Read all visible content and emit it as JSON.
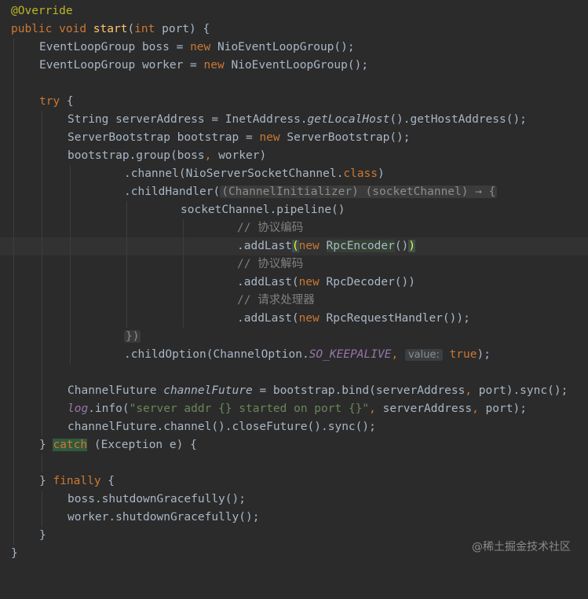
{
  "editor": {
    "annotation": "@Override",
    "method_line": {
      "mod1": "public",
      "mod2": "void",
      "name": "start",
      "paren_open": "(",
      "ptype": "int",
      "pname": "port",
      "tail": ") {"
    },
    "boss_line": {
      "type": "EventLoopGroup boss = ",
      "kw": "new",
      "rest": " NioEventLoopGroup();"
    },
    "worker_line": {
      "type": "EventLoopGroup worker = ",
      "kw": "new",
      "rest": " NioEventLoopGroup();"
    },
    "try_line": {
      "kw": "try",
      "rest": " {"
    },
    "server_address_line": {
      "a": "String serverAddress = InetAddress.",
      "method": "getLocalHost",
      "b": "().getHostAddress();"
    },
    "bootstrap_line": {
      "a": "ServerBootstrap bootstrap = ",
      "kw": "new",
      "b": " ServerBootstrap();"
    },
    "group_line": {
      "a": "bootstrap.group(boss",
      "comma": ",",
      "b": " worker)"
    },
    "channel_line": {
      "a": ".channel(NioServerSocketChannel.",
      "kw": "class",
      "b": ")"
    },
    "child_handler_line": {
      "a": ".childHandler(",
      "fold": "(ChannelInitializer) (socketChannel) → {"
    },
    "pipeline_line": "socketChannel.pipeline()",
    "comment_encoder": "// 协议编码",
    "add_encoder_line": {
      "a": ".addLast",
      "open": "(",
      "kw": "new",
      "space": " ",
      "cls": "RpcEncoder",
      "b": "()",
      "close": ")"
    },
    "comment_decoder": "// 协议解码",
    "add_decoder_line": {
      "a": ".addLast(",
      "kw": "new",
      "b": " RpcDecoder())"
    },
    "comment_handler": "// 请求处理器",
    "add_handler_line": {
      "a": ".addLast(",
      "kw": "new",
      "b": " RpcRequestHandler());"
    },
    "close_fold_line": "})",
    "child_option_line": {
      "a": ".childOption(ChannelOption.",
      "const": "SO_KEEPALIVE",
      "comma": ",",
      "hint": "value:",
      "val": "true",
      "b": ");"
    },
    "future_line": {
      "a": "ChannelFuture ",
      "var": "channelFuture",
      "b": " = bootstrap.bind(serverAddress",
      "c1": ",",
      "c": " port).sync();"
    },
    "log_line": {
      "log": "log",
      "a": ".info(",
      "str": "\"server addr {} started on port {}\"",
      "c1": ",",
      "b": " serverAddress",
      "c2": ",",
      "c": " port);"
    },
    "close_future_line": "channelFuture.channel().closeFuture().sync();",
    "catch_line": {
      "a": "} ",
      "kw": "catch",
      "b": " (Exception e) {"
    },
    "finally_line": {
      "a": "} ",
      "kw": "finally",
      "b": " {"
    },
    "boss_shutdown": "boss.shutdownGracefully();",
    "worker_shutdown": "worker.shutdownGracefully();",
    "close_brace_inner": "}",
    "close_brace_outer": "}"
  },
  "watermark": "@稀土掘金技术社区",
  "colors": {
    "background": "#2b2b2b",
    "keyword": "#cc7832",
    "annotation": "#bbb529",
    "method_decl": "#ffc66d",
    "string": "#6a8759",
    "constant": "#9876aa",
    "comment": "#808080",
    "text": "#a9b7c6"
  }
}
